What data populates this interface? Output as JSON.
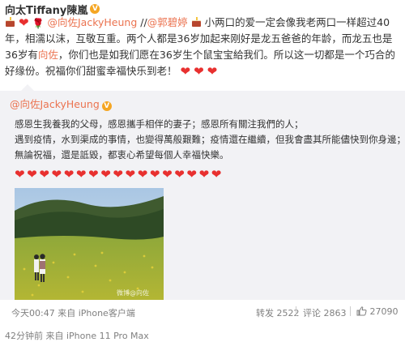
{
  "post": {
    "author": "向太Tiffany陳嵐",
    "text_parts": {
      "mention1": "@向佐JackyHeung",
      "sep": " //",
      "mention2": "@郭碧婷",
      "body": "小两口的爱一定会像我老两口一样超过40年，相濡以沫，互敬互重。两个人都是36岁加起来刚好是龙五爸爸的年龄，而龙五也是36岁有",
      "mention3": "向佐",
      "body2": "，你们也是如我们愿在36岁生个鼠宝宝給我们。所以这一切都是一个巧合的好缘份。祝福你们甜蜜幸福快乐到老！"
    }
  },
  "repost": {
    "author": "@向佐JackyHeung",
    "lines": [
      "感恩生我養我的父母，感恩攜手相伴的妻子；感恩所有關注我們的人；",
      "遇到疫情，水到渠成的事情，也變得萬般艱難；疫情還在繼續，但我會盡其所能儘快到你身邊；",
      "無論祝福，還是詆毀，都衷心希望每個人幸福快樂。"
    ],
    "heart_count": 17,
    "photo_watermark": "微博@向佐",
    "timestamp": "今天00:47 来自 iPhone客户端",
    "forward": "2522",
    "comment": "2863",
    "like": "27090"
  },
  "next_post_meta": "42分钟前 来自 iPhone 11 Pro Max",
  "icons": {
    "verified": "v-badge-icon",
    "forward": "forward-icon",
    "comment": "comment-icon",
    "like": "thumbs-up-icon"
  },
  "colors": {
    "mention": "#eb7350",
    "heart": "#e8302f",
    "bubble_bg": "#f2f2f5",
    "meta_text": "#808080"
  }
}
